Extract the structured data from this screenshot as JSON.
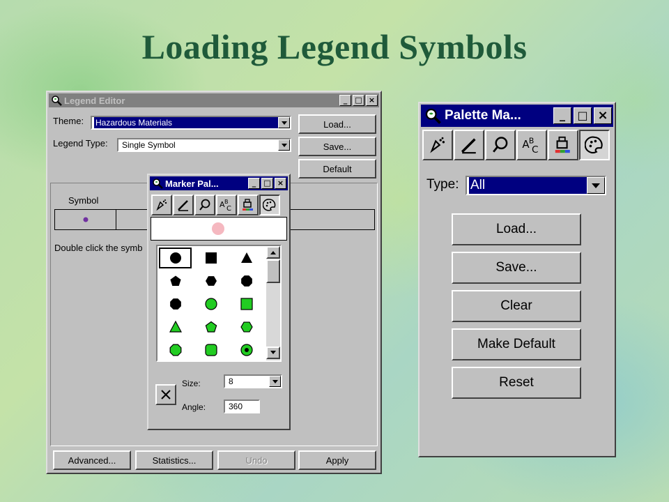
{
  "slide": {
    "title": "Loading Legend Symbols"
  },
  "legend_editor": {
    "title": "Legend Editor",
    "theme_label": "Theme:",
    "theme_value": "Hazardous Materials",
    "legend_type_label": "Legend Type:",
    "legend_type_value": "Single Symbol",
    "load_button": "Load...",
    "save_button": "Save...",
    "default_button": "Default",
    "symbol_column": "Symbol",
    "hint_text": "Double click the symb",
    "advanced_button": "Advanced...",
    "statistics_button": "Statistics...",
    "undo_button": "Undo",
    "apply_button": "Apply",
    "symbol_color": "#7030a0"
  },
  "marker_palette": {
    "title": "Marker Pal...",
    "preview_color": "#f5b8c0",
    "size_label": "Size:",
    "size_value": "8",
    "angle_label": "Angle:",
    "angle_value": "360",
    "tools": [
      "pen-tool-icon",
      "pencil-icon",
      "marker-icon",
      "text-abc-icon",
      "paint-bucket-icon",
      "palette-icon"
    ],
    "grid": [
      [
        {
          "shape": "circle",
          "color": "#000000"
        },
        {
          "shape": "square",
          "color": "#000000"
        },
        {
          "shape": "triangle",
          "color": "#000000"
        }
      ],
      [
        {
          "shape": "pentagon",
          "color": "#000000"
        },
        {
          "shape": "hexagon",
          "color": "#000000"
        },
        {
          "shape": "octagon",
          "color": "#000000"
        }
      ],
      [
        {
          "shape": "octagon",
          "color": "#000000"
        },
        {
          "shape": "circle",
          "color": "#22cc22"
        },
        {
          "shape": "square",
          "color": "#22cc22"
        }
      ],
      [
        {
          "shape": "triangle",
          "color": "#22cc22"
        },
        {
          "shape": "pentagon",
          "color": "#22cc22"
        },
        {
          "shape": "hexagon",
          "color": "#22cc22"
        }
      ],
      [
        {
          "shape": "octagon",
          "color": "#22cc22"
        },
        {
          "shape": "rounded-square",
          "color": "#22cc22"
        },
        {
          "shape": "target",
          "color": "#22cc22"
        }
      ]
    ]
  },
  "palette_manager": {
    "title": "Palette Ma...",
    "type_label": "Type:",
    "type_value": "All",
    "load_button": "Load...",
    "save_button": "Save...",
    "clear_button": "Clear",
    "make_default_button": "Make Default",
    "reset_button": "Reset",
    "tools": [
      "pen-tool-icon",
      "pencil-icon",
      "marker-icon",
      "text-abc-icon",
      "paint-bucket-icon",
      "palette-icon"
    ]
  },
  "colors": {
    "title_green": "#1f5a3a",
    "active_title": "#000080",
    "inactive_title": "#808080",
    "face": "#c0c0c0"
  }
}
